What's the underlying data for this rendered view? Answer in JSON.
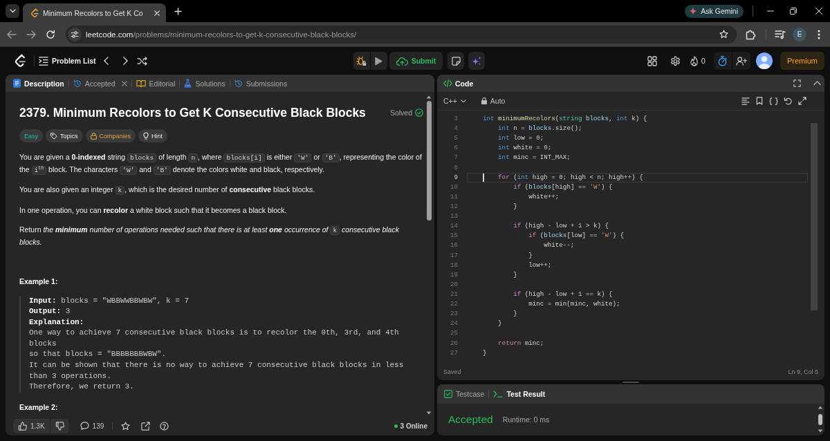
{
  "browser": {
    "tab_title": "Minimum Recolors to Get K Co",
    "gemini_label": "Ask Gemini",
    "url_host": "leetcode.com",
    "url_path": "/problems/minimum-recolors-to-get-k-consecutive-black-blocks/",
    "profile_initial": "E"
  },
  "navbar": {
    "problem_list": "Problem List",
    "submit": "Submit",
    "streak": "0",
    "premium": "Premium"
  },
  "description_panel": {
    "tabs": [
      {
        "kind": "description",
        "label": "Description",
        "selected": true,
        "closable": false
      },
      {
        "kind": "accepted",
        "label": "Accepted",
        "selected": false,
        "closable": true
      },
      {
        "kind": "editorial",
        "label": "Editorial",
        "selected": false,
        "closable": false
      },
      {
        "kind": "solutions",
        "label": "Solutions",
        "selected": false,
        "closable": false
      },
      {
        "kind": "submissions",
        "label": "Submissions",
        "selected": false,
        "closable": false
      }
    ],
    "title": "2379. Minimum Recolors to Get K Consecutive Black Blocks",
    "status": "Solved",
    "difficulty": "Easy",
    "tags": [
      {
        "kind": "topics",
        "label": "Topics"
      },
      {
        "kind": "companies",
        "label": "Companies"
      },
      {
        "kind": "hint",
        "label": "Hint"
      }
    ],
    "paragraphs": [
      {
        "runs": [
          {
            "kind": "text",
            "text": "You are given a **0-indexed** string "
          },
          {
            "kind": "code",
            "text": "blocks"
          },
          {
            "kind": "text",
            "text": " of length "
          },
          {
            "kind": "code",
            "text": "n"
          },
          {
            "kind": "text",
            "text": ", where "
          },
          {
            "kind": "code",
            "text": "blocks[i]"
          },
          {
            "kind": "text",
            "text": " is either "
          },
          {
            "kind": "code",
            "text": "'W'"
          },
          {
            "kind": "text",
            "text": " or "
          },
          {
            "kind": "code",
            "text": "'B'"
          },
          {
            "kind": "text",
            "text": ", representing the color of the "
          },
          {
            "kind": "code",
            "text": "i$^{th}$"
          },
          {
            "kind": "text",
            "text": " block. The characters "
          },
          {
            "kind": "code",
            "text": "'W'"
          },
          {
            "kind": "text",
            "text": " and "
          },
          {
            "kind": "code",
            "text": "'B'"
          },
          {
            "kind": "text",
            "text": " denote the colors white and black, respectively."
          }
        ]
      },
      {
        "runs": [
          {
            "kind": "text",
            "text": "You are also given an integer "
          },
          {
            "kind": "code",
            "text": "k"
          },
          {
            "kind": "text",
            "text": ", which is the desired number of **consecutive** black blocks."
          }
        ]
      },
      {
        "runs": [
          {
            "kind": "text",
            "text": "In one operation, you can **recolor** a white block such that it becomes a black block."
          }
        ]
      },
      {
        "runs": [
          {
            "kind": "text",
            "text": "Return "
          },
          {
            "kind": "em",
            "text": "the **minimum** number of operations needed such that there is at least **one** occurrence of "
          },
          {
            "kind": "code",
            "text": "k"
          },
          {
            "kind": "em",
            "text": " consecutive black blocks."
          }
        ]
      }
    ],
    "examples": [
      {
        "heading": "Example 1:",
        "input_label": "Input:",
        "input": "blocks = \"WBBWWBBWBW\", k = 7",
        "output_label": "Output:",
        "output": "3",
        "explanation_label": "Explanation:",
        "explanation": [
          "One way to achieve 7 consecutive black blocks is to recolor the 0th, 3rd, and 4th blocks",
          "so that blocks = \"BBBBBBBWBW\".",
          "It can be shown that there is no way to achieve 7 consecutive black blocks in less than 3 operations.",
          "Therefore, we return 3."
        ]
      },
      {
        "heading": "Example 2:"
      }
    ],
    "footer": {
      "likes": "1.3K",
      "comments": "139",
      "online": "3 Online"
    }
  },
  "code_panel": {
    "title": "Code",
    "language": "C++",
    "mode": "Auto",
    "lines": [
      {
        "number": "3",
        "active": false,
        "tokens": [
          {
            "kind": "type",
            "text": "    int"
          },
          {
            "kind": "func",
            "text": " minimumRecolors"
          },
          {
            "kind": "plain",
            "text": "("
          },
          {
            "kind": "class",
            "text": "string"
          },
          {
            "kind": "param",
            "text": " blocks"
          },
          {
            "kind": "plain",
            "text": ", "
          },
          {
            "kind": "type",
            "text": "int"
          },
          {
            "kind": "plain",
            "text": " k) {"
          }
        ]
      },
      {
        "number": "4",
        "active": false,
        "tokens": [
          {
            "kind": "type",
            "text": "        int"
          },
          {
            "kind": "plain",
            "text": " n = "
          },
          {
            "kind": "param",
            "text": "blocks"
          },
          {
            "kind": "plain",
            "text": ".size();"
          }
        ]
      },
      {
        "number": "5",
        "active": false,
        "tokens": [
          {
            "kind": "type",
            "text": "        int"
          },
          {
            "kind": "plain",
            "text": " low = "
          },
          {
            "kind": "num",
            "text": "0"
          },
          {
            "kind": "plain",
            "text": ";"
          }
        ]
      },
      {
        "number": "6",
        "active": false,
        "tokens": [
          {
            "kind": "type",
            "text": "        int"
          },
          {
            "kind": "plain",
            "text": " white = "
          },
          {
            "kind": "num",
            "text": "0"
          },
          {
            "kind": "plain",
            "text": ";"
          }
        ]
      },
      {
        "number": "7",
        "active": false,
        "tokens": [
          {
            "kind": "type",
            "text": "        int"
          },
          {
            "kind": "plain",
            "text": " minc = INT_MAX;"
          }
        ]
      },
      {
        "number": "8",
        "active": false
      },
      {
        "number": "9",
        "active": true,
        "tokens": [
          {
            "kind": "control",
            "text": "        for"
          },
          {
            "kind": "plain",
            "text": " ("
          },
          {
            "kind": "type",
            "text": "int"
          },
          {
            "kind": "plain",
            "text": " high = "
          },
          {
            "kind": "num",
            "text": "0"
          },
          {
            "kind": "plain",
            "text": "; high < n; high++) {"
          }
        ]
      },
      {
        "number": "10",
        "active": false,
        "tokens": [
          {
            "kind": "control",
            "text": "            if"
          },
          {
            "kind": "plain",
            "text": " ("
          },
          {
            "kind": "param",
            "text": "blocks"
          },
          {
            "kind": "plain",
            "text": "[high] == "
          },
          {
            "kind": "str",
            "text": "'W'"
          },
          {
            "kind": "plain",
            "text": ") {"
          }
        ]
      },
      {
        "number": "11",
        "active": false,
        "tokens": [
          {
            "kind": "plain",
            "text": "                white++;"
          }
        ]
      },
      {
        "number": "12",
        "active": false,
        "tokens": [
          {
            "kind": "plain",
            "text": "            }"
          }
        ]
      },
      {
        "number": "13",
        "active": false
      },
      {
        "number": "14",
        "active": false,
        "tokens": [
          {
            "kind": "control",
            "text": "            if"
          },
          {
            "kind": "plain",
            "text": " (high - low + "
          },
          {
            "kind": "num",
            "text": "1"
          },
          {
            "kind": "plain",
            "text": " > k) {"
          }
        ]
      },
      {
        "number": "15",
        "active": false,
        "tokens": [
          {
            "kind": "control",
            "text": "                if"
          },
          {
            "kind": "plain",
            "text": " ("
          },
          {
            "kind": "param",
            "text": "blocks"
          },
          {
            "kind": "plain",
            "text": "[low] == "
          },
          {
            "kind": "str",
            "text": "'W'"
          },
          {
            "kind": "plain",
            "text": ") {"
          }
        ]
      },
      {
        "number": "16",
        "active": false,
        "tokens": [
          {
            "kind": "plain",
            "text": "                    white--;"
          }
        ]
      },
      {
        "number": "17",
        "active": false,
        "tokens": [
          {
            "kind": "plain",
            "text": "                }"
          }
        ]
      },
      {
        "number": "18",
        "active": false,
        "tokens": [
          {
            "kind": "plain",
            "text": "                low++;"
          }
        ]
      },
      {
        "number": "19",
        "active": false,
        "tokens": [
          {
            "kind": "plain",
            "text": "            }"
          }
        ]
      },
      {
        "number": "20",
        "active": false
      },
      {
        "number": "21",
        "active": false,
        "tokens": [
          {
            "kind": "control",
            "text": "            if"
          },
          {
            "kind": "plain",
            "text": " (high - low + "
          },
          {
            "kind": "num",
            "text": "1"
          },
          {
            "kind": "plain",
            "text": " == k) {"
          }
        ]
      },
      {
        "number": "22",
        "active": false,
        "tokens": [
          {
            "kind": "plain",
            "text": "                minc = min(minc, white);"
          }
        ]
      },
      {
        "number": "23",
        "active": false,
        "tokens": [
          {
            "kind": "plain",
            "text": "            }"
          }
        ]
      },
      {
        "number": "24",
        "active": false,
        "tokens": [
          {
            "kind": "plain",
            "text": "        }"
          }
        ]
      },
      {
        "number": "25",
        "active": false
      },
      {
        "number": "26",
        "active": false,
        "tokens": [
          {
            "kind": "control",
            "text": "        return"
          },
          {
            "kind": "plain",
            "text": " minc;"
          }
        ]
      },
      {
        "number": "27",
        "active": false,
        "tokens": [
          {
            "kind": "plain",
            "text": "    }"
          }
        ]
      }
    ],
    "save_state": "Saved",
    "cursor_position": "Ln 9, Col 5"
  },
  "result_panel": {
    "tabs": [
      {
        "kind": "testcase",
        "label": "Testcase",
        "selected": false
      },
      {
        "kind": "result",
        "label": "Test Result",
        "selected": true
      }
    ],
    "verdict": "Accepted",
    "runtime": "Runtime: 0 ms"
  }
}
